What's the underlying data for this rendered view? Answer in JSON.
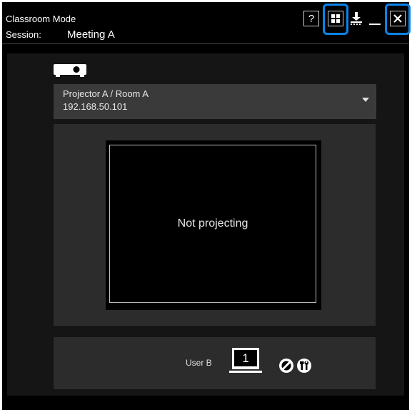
{
  "window": {
    "title": "Classroom Mode",
    "session_label": "Session:",
    "session_name": "Meeting A"
  },
  "toolbar": {
    "help": "?",
    "grid": "grid-icon",
    "download": "download-icon",
    "minimize": "minimize-icon",
    "close": "close-icon",
    "highlight_color": "#0a83e8"
  },
  "projector": {
    "icon": "projector-icon",
    "dropdown": {
      "name": "Projector A / Room A",
      "ip": "192.168.50.101"
    }
  },
  "preview": {
    "status": "Not projecting"
  },
  "user": {
    "name": "User B",
    "screen_number": "1",
    "icons": [
      "no-entry-icon",
      "tools-icon"
    ]
  }
}
